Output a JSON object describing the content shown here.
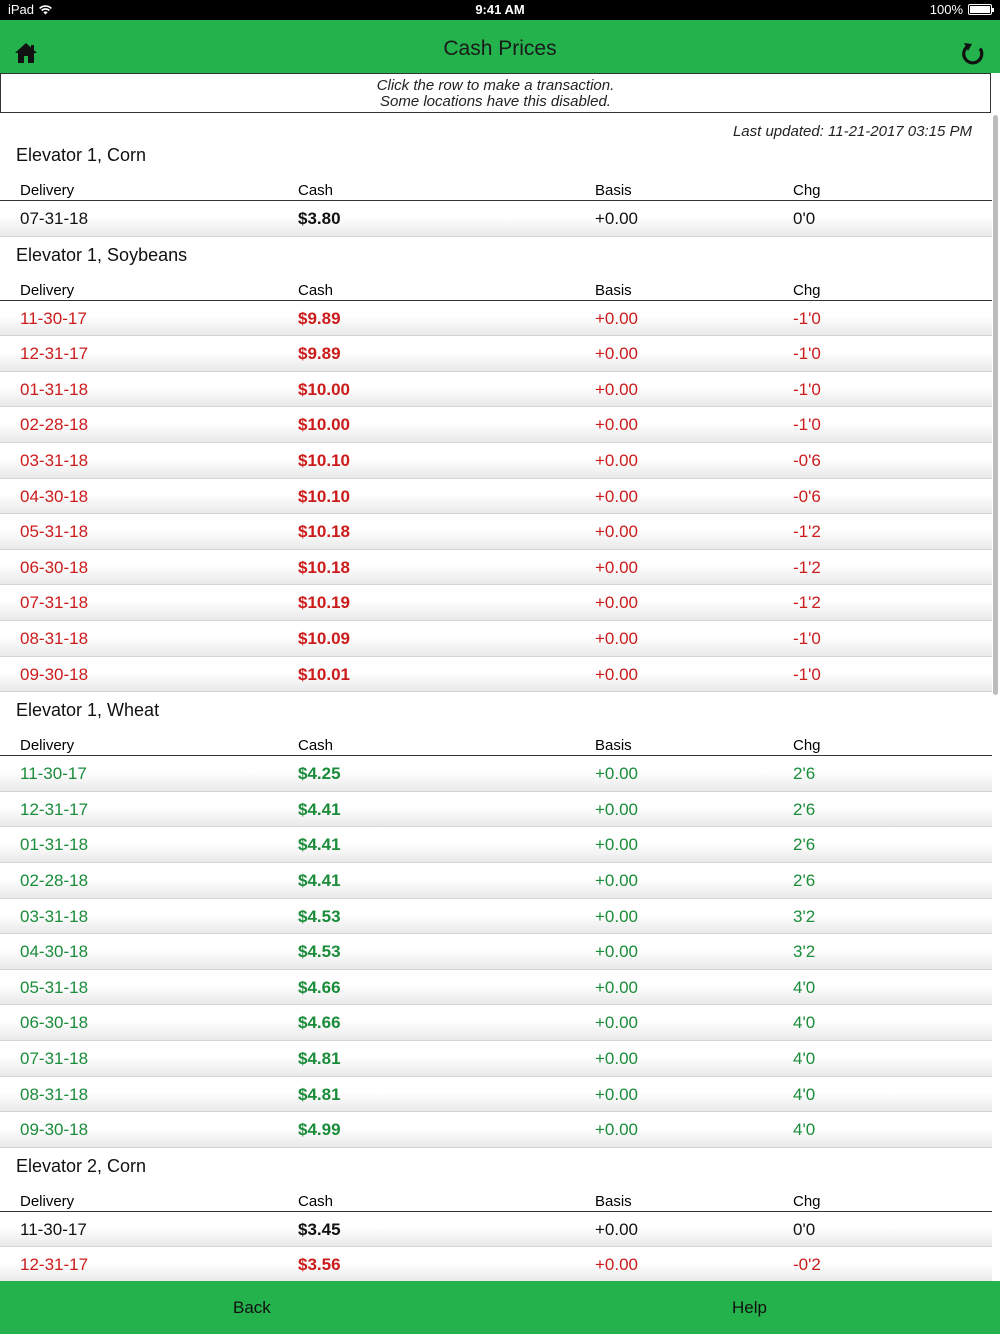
{
  "status_bar": {
    "device": "iPad",
    "time": "9:41 AM",
    "battery": "100%"
  },
  "nav": {
    "title": "Cash Prices"
  },
  "notice": {
    "line1": "Click the row to make a transaction.",
    "line2": "Some locations have this disabled."
  },
  "last_updated": "Last updated: 11-21-2017 03:15 PM",
  "columns": {
    "delivery": "Delivery",
    "cash": "Cash",
    "basis": "Basis",
    "chg": "Chg"
  },
  "sections": [
    {
      "title": "Elevator 1, Corn",
      "rows": [
        {
          "delivery": "07-31-18",
          "cash": "$3.80",
          "basis": "+0.00",
          "chg": "0'0",
          "trend": "flat"
        }
      ]
    },
    {
      "title": "Elevator 1, Soybeans",
      "rows": [
        {
          "delivery": "11-30-17",
          "cash": "$9.89",
          "basis": "+0.00",
          "chg": "-1'0",
          "trend": "down"
        },
        {
          "delivery": "12-31-17",
          "cash": "$9.89",
          "basis": "+0.00",
          "chg": "-1'0",
          "trend": "down"
        },
        {
          "delivery": "01-31-18",
          "cash": "$10.00",
          "basis": "+0.00",
          "chg": "-1'0",
          "trend": "down"
        },
        {
          "delivery": "02-28-18",
          "cash": "$10.00",
          "basis": "+0.00",
          "chg": "-1'0",
          "trend": "down"
        },
        {
          "delivery": "03-31-18",
          "cash": "$10.10",
          "basis": "+0.00",
          "chg": "-0'6",
          "trend": "down"
        },
        {
          "delivery": "04-30-18",
          "cash": "$10.10",
          "basis": "+0.00",
          "chg": "-0'6",
          "trend": "down"
        },
        {
          "delivery": "05-31-18",
          "cash": "$10.18",
          "basis": "+0.00",
          "chg": "-1'2",
          "trend": "down"
        },
        {
          "delivery": "06-30-18",
          "cash": "$10.18",
          "basis": "+0.00",
          "chg": "-1'2",
          "trend": "down"
        },
        {
          "delivery": "07-31-18",
          "cash": "$10.19",
          "basis": "+0.00",
          "chg": "-1'2",
          "trend": "down"
        },
        {
          "delivery": "08-31-18",
          "cash": "$10.09",
          "basis": "+0.00",
          "chg": "-1'0",
          "trend": "down"
        },
        {
          "delivery": "09-30-18",
          "cash": "$10.01",
          "basis": "+0.00",
          "chg": "-1'0",
          "trend": "down"
        }
      ]
    },
    {
      "title": "Elevator 1, Wheat",
      "rows": [
        {
          "delivery": "11-30-17",
          "cash": "$4.25",
          "basis": "+0.00",
          "chg": "2'6",
          "trend": "up"
        },
        {
          "delivery": "12-31-17",
          "cash": "$4.41",
          "basis": "+0.00",
          "chg": "2'6",
          "trend": "up"
        },
        {
          "delivery": "01-31-18",
          "cash": "$4.41",
          "basis": "+0.00",
          "chg": "2'6",
          "trend": "up"
        },
        {
          "delivery": "02-28-18",
          "cash": "$4.41",
          "basis": "+0.00",
          "chg": "2'6",
          "trend": "up"
        },
        {
          "delivery": "03-31-18",
          "cash": "$4.53",
          "basis": "+0.00",
          "chg": "3'2",
          "trend": "up"
        },
        {
          "delivery": "04-30-18",
          "cash": "$4.53",
          "basis": "+0.00",
          "chg": "3'2",
          "trend": "up"
        },
        {
          "delivery": "05-31-18",
          "cash": "$4.66",
          "basis": "+0.00",
          "chg": "4'0",
          "trend": "up"
        },
        {
          "delivery": "06-30-18",
          "cash": "$4.66",
          "basis": "+0.00",
          "chg": "4'0",
          "trend": "up"
        },
        {
          "delivery": "07-31-18",
          "cash": "$4.81",
          "basis": "+0.00",
          "chg": "4'0",
          "trend": "up"
        },
        {
          "delivery": "08-31-18",
          "cash": "$4.81",
          "basis": "+0.00",
          "chg": "4'0",
          "trend": "up"
        },
        {
          "delivery": "09-30-18",
          "cash": "$4.99",
          "basis": "+0.00",
          "chg": "4'0",
          "trend": "up"
        }
      ]
    },
    {
      "title": "Elevator 2, Corn",
      "rows": [
        {
          "delivery": "11-30-17",
          "cash": "$3.45",
          "basis": "+0.00",
          "chg": "0'0",
          "trend": "flat"
        },
        {
          "delivery": "12-31-17",
          "cash": "$3.56",
          "basis": "+0.00",
          "chg": "-0'2",
          "trend": "down"
        }
      ]
    }
  ],
  "tab_bar": {
    "back": "Back",
    "help": "Help"
  },
  "colors": {
    "accent": "#23b24b",
    "down": "#cc1b1b",
    "up": "#1a8c3a"
  },
  "icons": {
    "home": "home-icon",
    "refresh": "refresh-icon",
    "wifi": "wifi-icon",
    "battery": "battery-icon"
  }
}
